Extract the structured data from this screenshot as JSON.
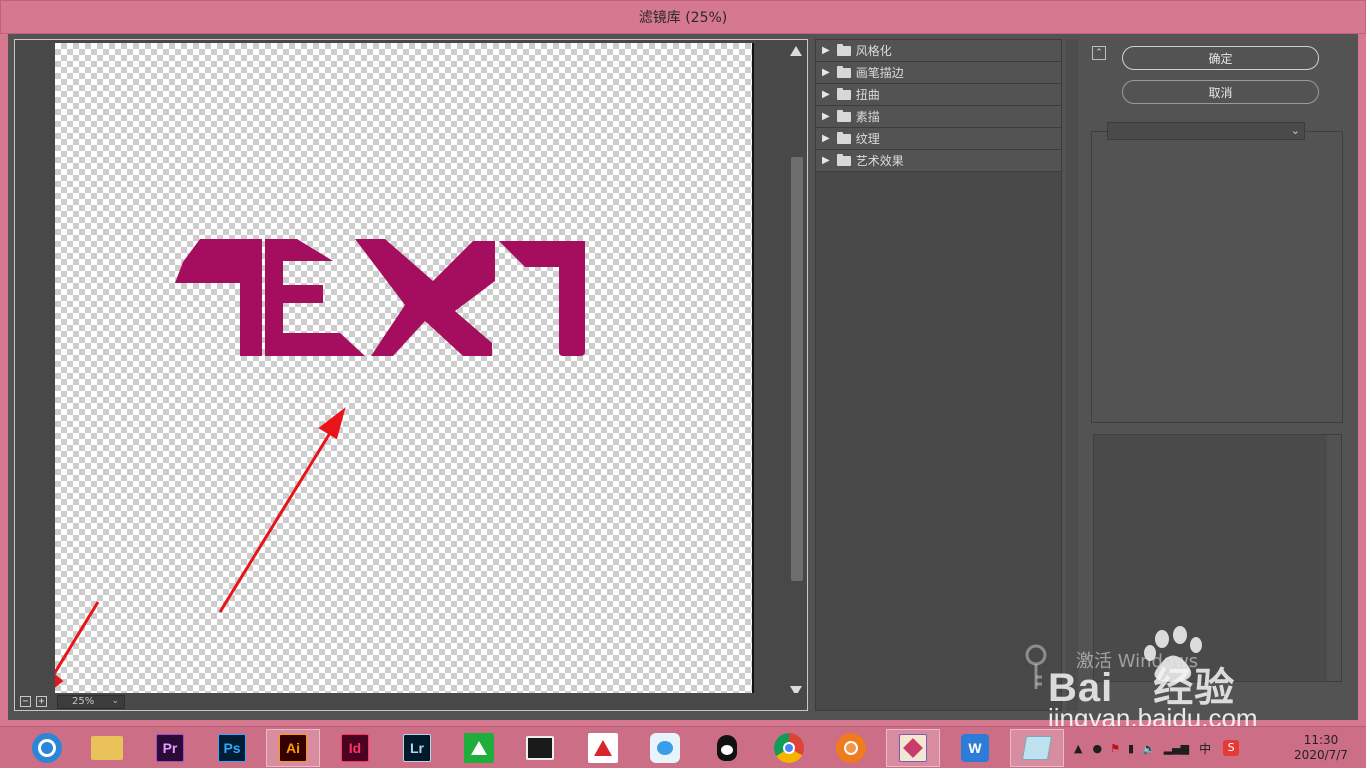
{
  "window": {
    "title": "滤镜库 (25%)"
  },
  "preview": {
    "zoom_label": "25%",
    "zoom_out_symbol": "−",
    "zoom_in_symbol": "+",
    "canvas_text": "TEXT",
    "text_color": "#a50e5e"
  },
  "filter_tree": {
    "items": [
      {
        "label": "风格化"
      },
      {
        "label": "画笔描边"
      },
      {
        "label": "扭曲"
      },
      {
        "label": "素描"
      },
      {
        "label": "纹理"
      },
      {
        "label": "艺术效果"
      }
    ]
  },
  "buttons": {
    "ok_label": "确定",
    "cancel_label": "取消"
  },
  "watermark": {
    "activate_text": "激活 Windows",
    "logo_text": "Bai",
    "logo_cn": "经验",
    "url_text": "jingyan.baidu.com"
  },
  "taskbar": {
    "apps": [
      {
        "name": "browser-360",
        "label": ""
      },
      {
        "name": "file-explorer",
        "label": ""
      },
      {
        "name": "premiere",
        "label": "Pr"
      },
      {
        "name": "photoshop",
        "label": "Ps"
      },
      {
        "name": "illustrator",
        "label": "Ai"
      },
      {
        "name": "indesign",
        "label": "Id"
      },
      {
        "name": "lightroom",
        "label": "Lr"
      },
      {
        "name": "green-app",
        "label": ""
      },
      {
        "name": "video-app",
        "label": ""
      },
      {
        "name": "red-green-app",
        "label": ""
      },
      {
        "name": "blue-bird-app",
        "label": ""
      },
      {
        "name": "qq",
        "label": ""
      },
      {
        "name": "chrome",
        "label": ""
      },
      {
        "name": "orange-app",
        "label": ""
      },
      {
        "name": "paint-app",
        "label": ""
      },
      {
        "name": "wps",
        "label": ""
      },
      {
        "name": "notes-app",
        "label": ""
      }
    ],
    "ime_label": "中",
    "clock_time": "11:30",
    "clock_date": "2020/7/7"
  },
  "colors": {
    "accent": "#d6788f",
    "dialog_bg": "#535353",
    "annotation_arrow": "#e8141a"
  }
}
